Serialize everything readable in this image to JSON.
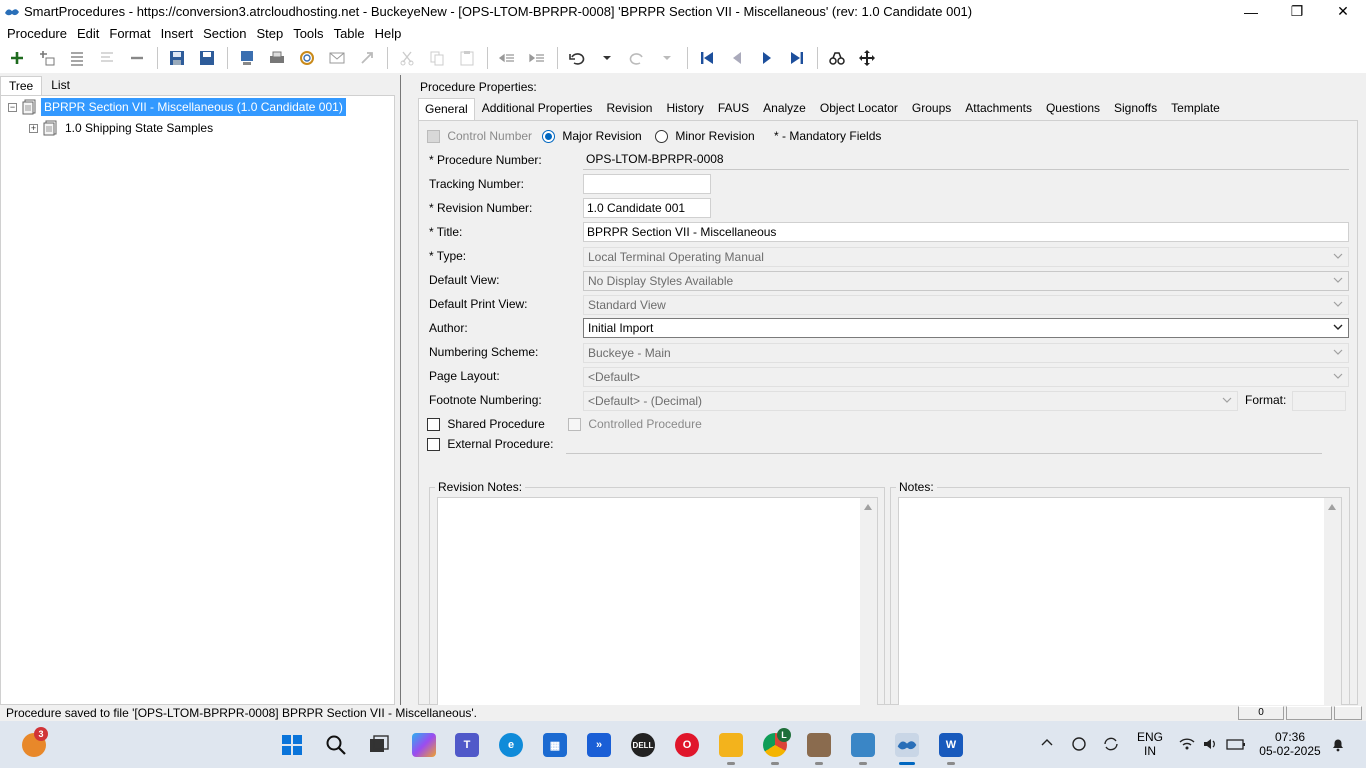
{
  "window": {
    "title": "SmartProcedures - https://conversion3.atrcloudhosting.net - BuckeyeNew - [OPS-LTOM-BPRPR-0008] 'BPRPR  Section VII - Miscellaneous' (rev: 1.0 Candidate 001)",
    "controls": {
      "minimize": "—",
      "maximize": "❐",
      "close": "✕"
    }
  },
  "menu": [
    "Procedure",
    "Edit",
    "Format",
    "Insert",
    "Section",
    "Step",
    "Tools",
    "Table",
    "Help"
  ],
  "left_panel": {
    "tabs": [
      "Tree",
      "List"
    ],
    "tree": {
      "root": {
        "toggle": "−",
        "label": "BPRPR  Section VII - Miscellaneous (1.0 Candidate 001)"
      },
      "child": {
        "toggle": "+",
        "label": "1.0 Shipping State Samples"
      }
    }
  },
  "right_panel": {
    "heading": "Procedure Properties:",
    "tabs": [
      "General",
      "Additional Properties",
      "Revision",
      "History",
      "FAUS",
      "Analyze",
      "Object Locator",
      "Groups",
      "Attachments",
      "Questions",
      "Signoffs",
      "Template"
    ],
    "general": {
      "control_number": "Control Number",
      "major_revision": "Major Revision",
      "minor_revision": "Minor Revision",
      "mandatory_note": "* - Mandatory Fields",
      "procedure_number_label": "* Procedure Number:",
      "procedure_number_value": "OPS-LTOM-BPRPR-0008",
      "tracking_number_label": "Tracking Number:",
      "tracking_number_value": "",
      "revision_number_label": "* Revision Number:",
      "revision_number_value": "1.0 Candidate 001",
      "title_label": "* Title:",
      "title_value": "BPRPR  Section VII - Miscellaneous",
      "type_label": "* Type:",
      "type_value": "Local Terminal Operating Manual",
      "default_view_label": "Default View:",
      "default_view_value": "No Display Styles Available",
      "default_print_view_label": "Default Print View:",
      "default_print_view_value": "Standard View",
      "author_label": "Author:",
      "author_value": "Initial Import",
      "numbering_scheme_label": "Numbering Scheme:",
      "numbering_scheme_value": "Buckeye - Main",
      "page_layout_label": "Page Layout:",
      "page_layout_value": "<Default>",
      "footnote_numbering_label": "Footnote Numbering:",
      "footnote_numbering_value": "<Default> - (Decimal)",
      "format_label": "Format:",
      "format_value": "",
      "shared_procedure": "Shared Procedure",
      "controlled_procedure": "Controlled Procedure",
      "external_procedure": "External Procedure:",
      "external_procedure_value": "",
      "revision_notes_label": "Revision Notes:",
      "notes_label": "Notes:"
    }
  },
  "status_bar": {
    "message": "Procedure saved to file '[OPS-LTOM-BPRPR-0008] BPRPR  Section VII - Miscellaneous'.",
    "panel1": "0",
    "panel2": ""
  },
  "taskbar": {
    "notification_badge": "3",
    "language": "ENG",
    "region": "IN",
    "time": "07:36",
    "date": "05-02-2025",
    "chrome_badge": "L"
  },
  "colors": {
    "selection": "#3399ff",
    "accent": "#0067c0",
    "taskbar": "#dfe6ef"
  }
}
